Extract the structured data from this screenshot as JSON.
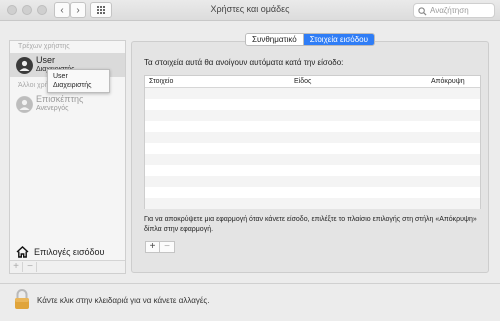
{
  "window": {
    "title": "Χρήστες και ομάδες"
  },
  "search": {
    "placeholder": "Αναζήτηση"
  },
  "sidebar": {
    "current_header": "Τρέχων χρήστης",
    "current_user": {
      "name": "User",
      "role": "Διαχειριστής"
    },
    "other_header": "Άλλοι χρήστες",
    "guest": {
      "name": "Επισκέπτης",
      "status": "Ανενεργός"
    },
    "login_options": "Επιλογές εισόδου",
    "add": "+",
    "remove": "−"
  },
  "tooltip": {
    "name": "User",
    "role": "Διαχειριστής"
  },
  "tabs": [
    {
      "label": "Συνθηματικό",
      "selected": false
    },
    {
      "label": "Στοιχεία εισόδου",
      "selected": true
    }
  ],
  "main": {
    "description": "Τα στοιχεία αυτά θα ανοίγουν αυτόματα κατά την είσοδο:",
    "columns": [
      "Στοιχείο",
      "Είδος",
      "Απόκρυψη"
    ],
    "note": "Για να αποκρύψετε μια εφαρμογή όταν κάνετε είσοδο, επιλέξτε το πλαίσιο επιλογής στη στήλη «Απόκρυψη» δίπλα στην εφαρμογή.",
    "add": "+",
    "remove": "−"
  },
  "footer": {
    "lock_text": "Κάντε κλικ στην κλειδαριά για να κάνετε αλλαγές."
  },
  "colors": {
    "accent": "#2f7df6",
    "lock": "#e0a43a"
  }
}
